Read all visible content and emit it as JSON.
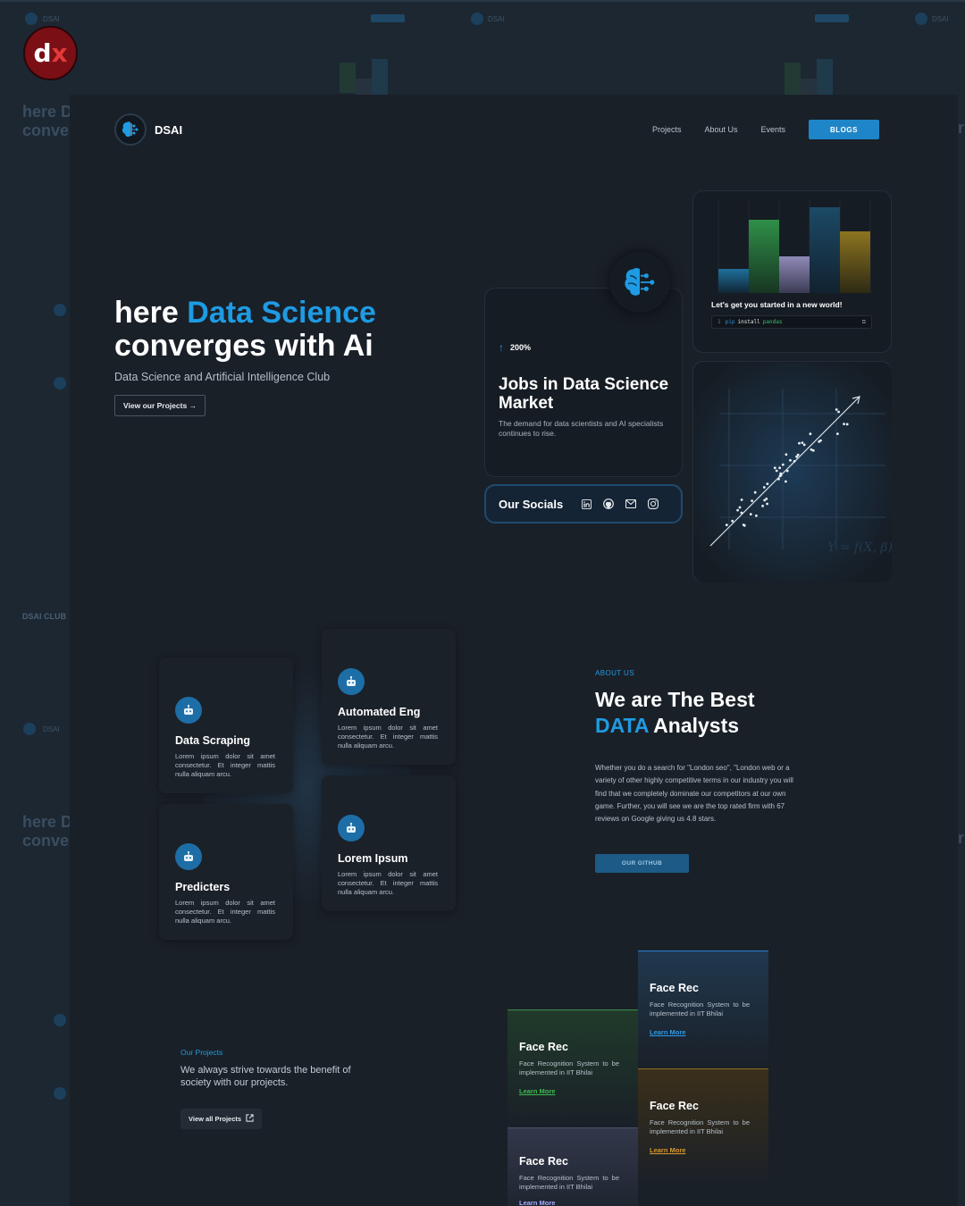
{
  "overlay_logo": {
    "text_main": "d",
    "text_accent": "x"
  },
  "background": {
    "brand": "DSAI",
    "hero_line1": "here D",
    "hero_line2": "conve",
    "club": "DSAI CLUB",
    "right_line1": "r",
    "right_line2": "r"
  },
  "nav": {
    "brand": "DSAI",
    "links": [
      "Projects",
      "About Us",
      "Events"
    ],
    "cta": "BLOGS"
  },
  "hero": {
    "title_part1": "here ",
    "title_highlight": "Data Science",
    "title_part2": "converges with Ai",
    "subtitle": "Data Science and Artificial Intelligence Club",
    "button": "View our  Projects →"
  },
  "jobs_card": {
    "stat": "200%",
    "title": "Jobs in Data Science Market",
    "description": "The demand for data scientists and AI specialists continues to rise."
  },
  "socials": {
    "label": "Our Socials",
    "icons": [
      "linkedin-icon",
      "github-icon",
      "mail-icon",
      "instagram-icon"
    ]
  },
  "chart_card": {
    "caption": "Let's get you started in a new world!",
    "code": {
      "line_no": "1",
      "keyword": "pip",
      "command": "install",
      "package": "pandas",
      "copy_glyph": "⧉"
    }
  },
  "scatter_card": {
    "formula": "Y = f(X, β) + ε"
  },
  "services": [
    {
      "title": "Data Scraping",
      "desc": "Lorem ipsum dolor sit amet consectetur. Et integer mattis nulla aliquam arcu."
    },
    {
      "title": "Automated Eng",
      "desc": "Lorem ipsum dolor sit amet consectetur. Et integer mattis nulla aliquam arcu."
    },
    {
      "title": "Predicters",
      "desc": "Lorem ipsum dolor sit amet consectetur. Et integer mattis nulla aliquam arcu."
    },
    {
      "title": "Lorem Ipsum",
      "desc": "Lorem ipsum dolor sit amet consectetur. Et integer mattis nulla aliquam arcu."
    }
  ],
  "about": {
    "eyebrow": "ABOUT US",
    "title_line1": "We are The Best",
    "title_highlight": "DATA",
    "title_rest": " Analysts",
    "body": "Whether you do a search for \"London seo\", \"London web or a variety of other highly competitive terms in our industry you will find that we completely dominate our competitors at our own game. Further, you will see we are the top rated firm with 67 reviews on Google giving us 4.8 stars.",
    "button": "OUR GITHUB"
  },
  "projects": {
    "eyebrow": "Our Projects",
    "description": "We always strive towards the benefit of society with our projects.",
    "button": "View all Projects",
    "cards": [
      {
        "title": "Face Rec",
        "desc": "Face Recognition System to be implemented in IIT Bhilai",
        "link": "Learn More",
        "accent": "#2d7fd0"
      },
      {
        "title": "Face Rec",
        "desc": "Face Recognition System to be implemented in IIT Bhilai",
        "link": "Learn More",
        "accent": "#3bbb4f"
      },
      {
        "title": "Face Rec",
        "desc": "Face Recognition System to be implemented in IIT Bhilai",
        "link": "Learn More",
        "accent": "#c98a2a"
      },
      {
        "title": "Face Rec",
        "desc": "Face Recognition System to be implemented in IIT Bhilai",
        "link": "Learn More",
        "accent": "#9aa3ff"
      }
    ]
  },
  "colors": {
    "accent": "#1e9be3",
    "page_bg": "#1a2028",
    "outer_bg": "#1c2732",
    "cta": "#1e86c8"
  }
}
